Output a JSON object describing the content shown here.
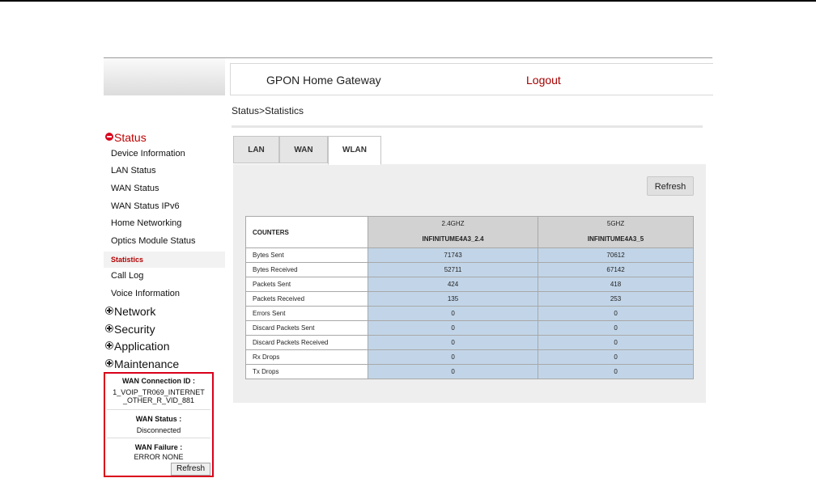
{
  "header": {
    "title": "GPON Home Gateway",
    "logout": "Logout"
  },
  "breadcrumb": "Status>Statistics",
  "sidebar": {
    "categories": [
      {
        "label": "Status",
        "expanded": true
      },
      {
        "label": "Network",
        "expanded": false
      },
      {
        "label": "Security",
        "expanded": false
      },
      {
        "label": "Application",
        "expanded": false
      },
      {
        "label": "Maintenance",
        "expanded": false
      }
    ],
    "status_items": [
      "Device Information",
      "LAN Status",
      "WAN Status",
      "WAN Status IPv6",
      "Home Networking",
      "Optics Module Status",
      "Statistics",
      "Call Log",
      "Voice Information"
    ],
    "active_item": "Statistics"
  },
  "wan_info": {
    "connection_id_label": "WAN Connection ID :",
    "connection_id_line1": "1_VOIP_TR069_INTERNET",
    "connection_id_line2": "_OTHER_R_VID_881",
    "status_label": "WAN Status :",
    "status_value": "Disconnected",
    "failure_label": "WAN Failure :",
    "failure_value": "ERROR NONE",
    "refresh": "Refresh"
  },
  "tabs": [
    {
      "label": "LAN",
      "active": false
    },
    {
      "label": "WAN",
      "active": false
    },
    {
      "label": "WLAN",
      "active": true
    }
  ],
  "refresh_button": "Refresh",
  "table": {
    "counters_header": "COUNTERS",
    "columns": [
      {
        "band": "2.4GHZ",
        "ssid": "INFINITUME4A3_2.4"
      },
      {
        "band": "5GHZ",
        "ssid": "INFINITUME4A3_5"
      }
    ],
    "rows": [
      {
        "label": "Bytes Sent",
        "values": [
          "71743",
          "70612"
        ]
      },
      {
        "label": "Bytes Received",
        "values": [
          "52711",
          "67142"
        ]
      },
      {
        "label": "Packets Sent",
        "values": [
          "424",
          "418"
        ]
      },
      {
        "label": "Packets Received",
        "values": [
          "135",
          "253"
        ]
      },
      {
        "label": "Errors Sent",
        "values": [
          "0",
          "0"
        ]
      },
      {
        "label": "Discard Packets Sent",
        "values": [
          "0",
          "0"
        ]
      },
      {
        "label": "Discard Packets Received",
        "values": [
          "0",
          "0"
        ]
      },
      {
        "label": "Rx Drops",
        "values": [
          "0",
          "0"
        ]
      },
      {
        "label": "Tx Drops",
        "values": [
          "0",
          "0"
        ]
      }
    ]
  },
  "colors": {
    "accent_red": "#c00000",
    "value_cell": "#c2d5e8",
    "header_cell": "#d2d2d2",
    "panel_bg": "#eeeeee"
  }
}
